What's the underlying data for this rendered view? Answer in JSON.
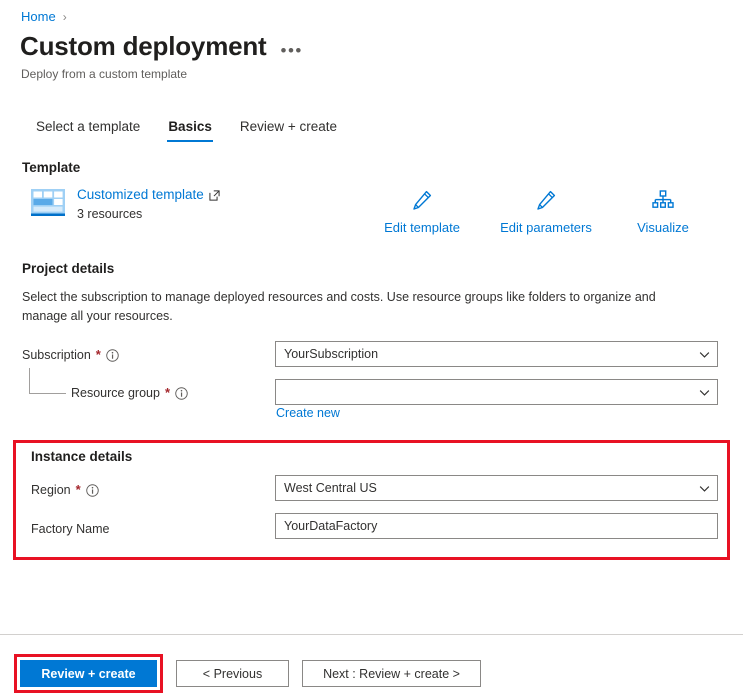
{
  "breadcrumb": {
    "home": "Home",
    "separator": "›"
  },
  "header": {
    "title": "Custom deployment",
    "subtitle": "Deploy from a custom template",
    "more_label": "•••"
  },
  "tabs": [
    {
      "label": "Select a template",
      "active": false
    },
    {
      "label": "Basics",
      "active": true
    },
    {
      "label": "Review + create",
      "active": false
    }
  ],
  "template": {
    "heading": "Template",
    "link_label": "Customized template",
    "resources_label": "3 resources",
    "actions": [
      {
        "label": "Edit template",
        "icon": "pencil-icon"
      },
      {
        "label": "Edit parameters",
        "icon": "pencil-icon"
      },
      {
        "label": "Visualize",
        "icon": "sitemap-icon"
      }
    ]
  },
  "project_details": {
    "heading": "Project details",
    "description": "Select the subscription to manage deployed resources and costs. Use resource groups like folders to organize and manage all your resources.",
    "subscription": {
      "label": "Subscription",
      "required": "*",
      "value": "YourSubscription",
      "placeholder": ""
    },
    "resource_group": {
      "label": "Resource group",
      "required": "*",
      "value": "",
      "placeholder": ""
    },
    "create_new_label": "Create new"
  },
  "instance_details": {
    "heading": "Instance details",
    "region": {
      "label": "Region",
      "required": "*",
      "value": "West Central US"
    },
    "factory_name": {
      "label": "Factory Name",
      "value": "YourDataFactory",
      "placeholder": ""
    }
  },
  "footer": {
    "review_create": "Review + create",
    "previous": "< Previous",
    "next": "Next : Review + create >"
  },
  "colors": {
    "accent": "#0078d4",
    "highlight": "#e81123",
    "required": "#a4262c",
    "border": "#8a8886"
  }
}
